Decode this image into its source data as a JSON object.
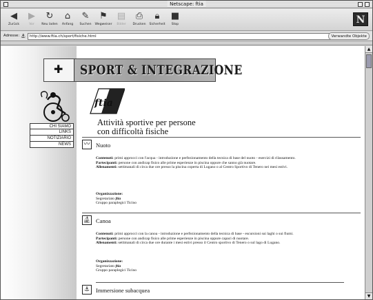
{
  "window": {
    "title": "Netscape: ftia"
  },
  "toolbar": {
    "buttons": [
      {
        "label": "Zurück",
        "icon": "back-arrow-icon",
        "enabled": true
      },
      {
        "label": "Vor",
        "icon": "forward-arrow-icon",
        "enabled": false
      },
      {
        "label": "Neu laden",
        "icon": "reload-icon",
        "enabled": true
      },
      {
        "label": "Anfang",
        "icon": "home-icon",
        "enabled": true
      },
      {
        "label": "Suchen",
        "icon": "search-icon",
        "enabled": true
      },
      {
        "label": "Wegweiser",
        "icon": "guide-icon",
        "enabled": true
      },
      {
        "label": "Bilder",
        "icon": "images-icon",
        "enabled": false
      },
      {
        "label": "Drucken",
        "icon": "print-icon",
        "enabled": true
      },
      {
        "label": "Sicherheit",
        "icon": "security-icon",
        "enabled": true
      },
      {
        "label": "Stop",
        "icon": "stop-icon",
        "enabled": true
      }
    ],
    "brand": "N"
  },
  "address": {
    "label": "Adresse:",
    "url": "http://www.ftia.ch/sport/fisiche.html",
    "related_label": "Verwandte Objekte"
  },
  "page": {
    "banner_title": "SPORT & INTEGRAZIONE",
    "nav": [
      "CHI SIAMO",
      "LINKS",
      "NOTIZIARIO",
      "NEWS"
    ],
    "title_line1": "Attività sportive per persone",
    "title_line2": "con difficoltà fisiche",
    "logo_text": "ftia",
    "sections": [
      {
        "title": "Nuoto",
        "contenuti_label": "Contenuti:",
        "contenuti": "primi approcci con l'acqua - introduzione e perfezionamento della tecnica di base del nuoto - esercizi di rilassamento.",
        "partecipanti_label": "Partecipanti:",
        "partecipanti": "persone con andicap fisico alle prime esperienze in piscina oppure che sanno già nuotare.",
        "allenamenti_label": "Allenamenti:",
        "allenamenti": "settimanali di circa due ore presso la piscina coperta di Lugano o al Centro Sportivo di Tenero nei mesi estivi.",
        "org_label": "Organizzazione:",
        "org_line1": "Segretariato",
        "org_line1_brand": "ftia",
        "org_line2": "Gruppo paraplegici Ticino"
      },
      {
        "title": "Canoa",
        "contenuti_label": "Contenuti:",
        "contenuti": "primi approcci con la canoa - introduzione e perfezionamento della tecnica di base - escursioni sui laghi o sui fiumi.",
        "partecipanti_label": "Partecipanti:",
        "partecipanti": "persone con andicap fisico alle prime esperienze in piscina oppure capaci di nuotare.",
        "allenamenti_label": "Allenamenti:",
        "allenamenti": "settimanali di circa due ore durante i mesi estivi presso il Centro sportivo di Tenero o sul lago di Lugano.",
        "org_label": "Organizzazione:",
        "org_line1": "Segretariato",
        "org_line1_brand": "ftia",
        "org_line2": "Gruppo paraplegici Ticino"
      },
      {
        "title": "Immersione subacquea"
      }
    ]
  }
}
